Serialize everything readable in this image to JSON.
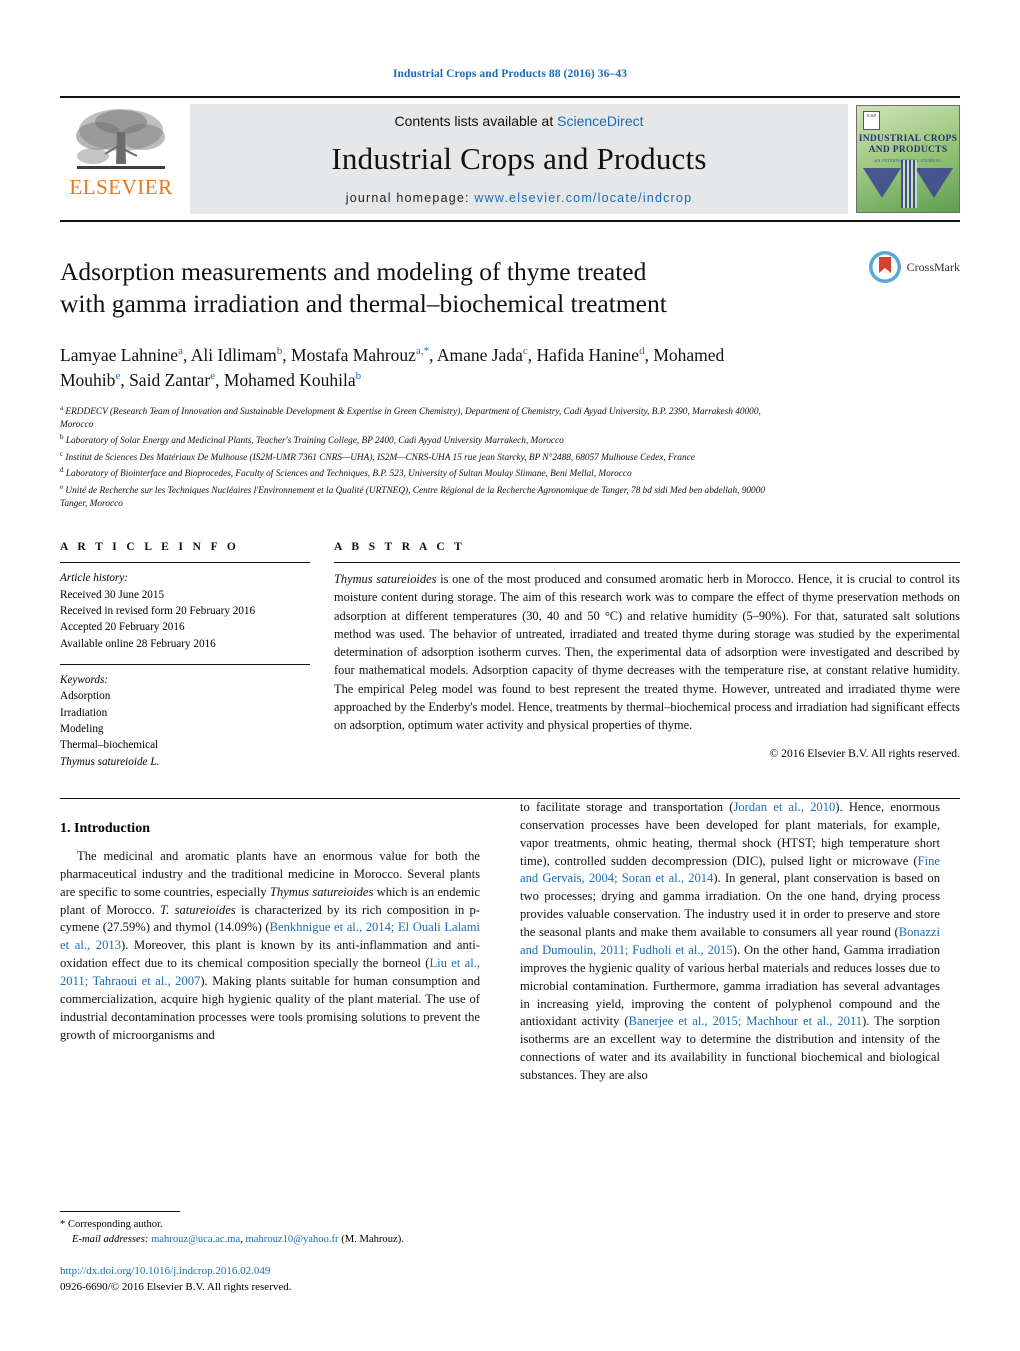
{
  "running_head": "Industrial Crops and Products 88 (2016) 36–43",
  "masthead": {
    "contents_prefix": "Contents lists available at ",
    "sciencedirect": "ScienceDirect",
    "journal_title": "Industrial Crops and Products",
    "homepage_prefix": "journal homepage:",
    "homepage_url": "www.elsevier.com/locate/indcrop",
    "publisher_word": "ELSEVIER",
    "publisher_logo_name": "elsevier-tree-logo",
    "cover": {
      "title_line1": "INDUSTRIAL CROPS",
      "title_line2": "AND PRODUCTS",
      "subtitle": "AN INTERNATIONAL JOURNAL"
    },
    "colors": {
      "link": "#1a6bb5",
      "elsevier_orange": "#E87722",
      "band_gray": "#e6e7e8"
    }
  },
  "title": "Adsorption measurements and modeling of thyme treated with gamma irradiation and thermal–biochemical treatment",
  "crossmark_label": "CrossMark",
  "authors_html": "Lamyae Lahnine<sup>a</sup>, Ali Idlimam<sup>b</sup>, Mostafa Mahrouz<sup>a,</sup><sup class=\"star\">*</sup>, Amane Jada<sup>c</sup>, Hafida Hanine<sup>d</sup>, Mohamed Mouhib<sup>e</sup>, Said Zantar<sup>e</sup>, Mohamed Kouhila<sup>b</sup>",
  "affiliations": [
    "a ERDDECV (Research Team of Innovation and Sustainable Development & Expertise in Green Chemistry), Department of Chemistry, Cadi Ayyad University, B.P. 2390, Marrakesh 40000, Morocco",
    "b Laboratory of Solar Energy and Medicinal Plants, Teacher's Training College, BP 2400, Cadi Ayyad University Marrakech, Morocco",
    "c Institut de Sciences Des Matériaux De Mulhouse (IS2M-UMR 7361 CNRS—UHA), IS2M—CNRS-UHA 15 rue jean Starcky, BP N°2488, 68057 Mulhouse Cedex, France",
    "d Laboratory of Biointerface and Bioprocedes, Faculty of Sciences and Techniques, B.P. 523, University of Sultan Moulay Slimane, Beni Mellal, Morocco",
    "e Unité de Recherche sur les Techniques Nucléaires l'Environnement et la Qualité (URTNEQ), Centre Régional de la Recherche Agronomique de Tanger, 78 bd sidi Med ben abdellah, 90000 Tanger, Morocco"
  ],
  "article_info": {
    "label": "A R T I C L E   I N F O",
    "history_label": "Article history:",
    "history": [
      "Received 30 June 2015",
      "Received in revised form 20 February 2016",
      "Accepted 20 February 2016",
      "Available online 28 February 2016"
    ],
    "keywords_label": "Keywords:",
    "keywords": [
      "Adsorption",
      "Irradiation",
      "Modeling",
      "Thermal–biochemical",
      "Thymus satureioide L."
    ]
  },
  "abstract": {
    "label": "A B S T R A C T",
    "lead_italic": "Thymus satureioides",
    "text": " is one of the most produced and consumed aromatic herb in Morocco. Hence, it is crucial to control its moisture content during storage. The aim of this research work was to compare the effect of thyme preservation methods on adsorption at different temperatures (30, 40 and 50 °C) and relative humidity (5–90%). For that, saturated salt solutions method was used. The behavior of untreated, irradiated and treated thyme during storage was studied by the experimental determination of adsorption isotherm curves. Then, the experimental data of adsorption were investigated and described by four mathematical models. Adsorption capacity of thyme decreases with the temperature rise, at constant relative humidity. The empirical Peleg model was found to best represent the treated thyme. However, untreated and irradiated thyme were approached by the Enderby's model. Hence, treatments by thermal–biochemical process and irradiation had significant effects on adsorption, optimum water activity and physical properties of thyme.",
    "copyright": "© 2016 Elsevier B.V. All rights reserved."
  },
  "introduction": {
    "heading": "1.  Introduction",
    "left_para_html": "The medicinal and aromatic plants have an enormous value for both the pharmaceutical industry and the traditional medicine in Morocco. Several plants are specific to some countries, especially <span class=\"it\">Thymus satureioides</span> which is an endemic plant of Morocco. <span class=\"it\">T. satureioides</span> is characterized by its rich composition in p-cymene (27.59%) and thymol (14.09%) (<span class=\"ref\">Benkhnigue et al., 2014; El Ouali Lalami et al., 2013</span>). Moreover, this plant is known by its anti-inflammation and anti-oxidation effect due to its chemical composition specially the borneol (<span class=\"ref\">Liu et al., 2011; Tahraoui et al., 2007</span>). Making plants suitable for human consumption and commercialization, acquire high hygienic quality of the plant material. The use of industrial decontamination processes were tools promising solutions to prevent the growth of microorganisms and",
    "right_para_html": "to facilitate storage and transportation (<span class=\"ref\">Jordan et al., 2010</span>). Hence, enormous conservation processes have been developed for plant materials, for example, vapor treatments, ohmic heating, thermal shock (HTST; high temperature short time), controlled sudden decompression (DIC), pulsed light or microwave (<span class=\"ref\">Fine and Gervais, 2004; Soran et al., 2014</span>). In general, plant conservation is based on two processes; drying and gamma irradiation. On the one hand, drying process provides valuable conservation. The industry used it in order to preserve and store the seasonal plants and make them available to consumers all year round (<span class=\"ref\">Bonazzi and Dumoulin, 2011; Fudholi et al., 2015</span>). On the other hand, Gamma irradiation improves the hygienic quality of various herbal materials and reduces losses due to microbial contamination. Furthermore, gamma irradiation has several advantages in increasing yield, improving the content of polyphenol compound and the antioxidant activity (<span class=\"ref\">Banerjee et al., 2015; Machhour et al., 2011</span>). The sorption isotherms are an excellent way to determine the distribution and intensity of the connections of water and its availability in functional biochemical and biological substances. They are also"
  },
  "footnote": {
    "corresponding_marker": "*",
    "corresponding_text": "Corresponding author.",
    "email_label": "E-mail addresses:",
    "email1": "mahrouz@uca.ac.ma",
    "email2": "mahrouz10@yahoo.fr",
    "email_suffix": "(M. Mahrouz)."
  },
  "doi": {
    "url": "http://dx.doi.org/10.1016/j.indcrop.2016.02.049",
    "issn_line": "0926-6690/© 2016 Elsevier B.V. All rights reserved."
  }
}
